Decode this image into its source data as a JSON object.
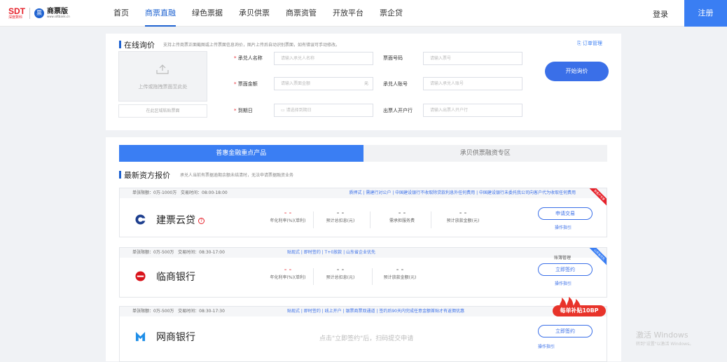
{
  "header": {
    "logo_sdt": "SDT",
    "logo_sdt_sub": "深度数科",
    "logo_name": "商票版",
    "logo_sub": "www.sdtbank.cn",
    "menu": [
      "首页",
      "商票直融",
      "绿色票据",
      "承贝供票",
      "商票资管",
      "开放平台",
      "票企贷"
    ],
    "active_menu": "商票直融",
    "login": "登录",
    "register": "注册"
  },
  "inquiry": {
    "title": "在线询价",
    "note": "支持上传商票正面截图或上传票面信息询价，图片上传后自动识别票面，如有错误可手动修改。",
    "order_mgmt": "订单管理",
    "upload_text": "上传或拖拽票面至此处",
    "paste_text": "在此区域粘贴票面",
    "fields": {
      "acceptor_label": "承兑人名称",
      "acceptor_ph": "请输入承兑人名称",
      "amount_label": "票面金额",
      "amount_ph": "请输入票面金额",
      "amount_unit": "元",
      "due_label": "到期日",
      "due_ph": "请选择到期日",
      "billno_label": "票面号码",
      "billno_ph": "请输入票号",
      "account_label": "承兑人账号",
      "account_ph": "请输入承兑人账号",
      "bank_label": "出票人开户行",
      "bank_ph": "请输入出票人开户行"
    },
    "start_button": "开始询价"
  },
  "tabs": [
    "普惠金融重点产品",
    "承贝供票融资专区"
  ],
  "assets": {
    "title": "最新资方报价",
    "note": "承兑人当前有票据逾期余额未结清时，无法申请票据融资业务"
  },
  "cards": [
    {
      "limit": "单张限额：0万-1000万",
      "hours": "交易时间：08:00-18:00",
      "tags": "质押式 | 需建行对公户 | 中国建设银行不收取除贷款利息外任何费用 | 中国建设银行未委托我公司向客户代为收取任何费用",
      "name": "建票云贷",
      "stats": [
        {
          "value": "- -",
          "label": "年化利率(%)(单利)",
          "red": true
        },
        {
          "value": "- -",
          "label": "预计总扣息(元)"
        },
        {
          "value": "- -",
          "label": "需承担服务费"
        },
        {
          "value": "- -",
          "label": "预计放款金额(元)"
        }
      ],
      "button": "申请交易",
      "guide": "操作指引",
      "ribbon": "新客户专享"
    },
    {
      "limit": "单张限额：0万-500万",
      "hours": "交易时间：08:30-17:00",
      "tags": "贴现式 | 即时签约 | T+0放款 | 山东省企业优先",
      "name": "临商银行",
      "stats": [
        {
          "value": "- -",
          "label": "年化利率(%)(单利)",
          "red": true
        },
        {
          "value": "- -",
          "label": "预计总扣息(元)"
        },
        {
          "value": "- -",
          "label": "预计放款金额(元)"
        }
      ],
      "extra_link": "账簿管理",
      "button": "立即签约",
      "guide": "操作指引",
      "ribbon": "山东省优先"
    },
    {
      "limit": "单张限额：0万-500万",
      "hours": "交易时间：08:30-17:30",
      "tags": "贴现式 | 即时签约 | 线上开户 | 银票商票双通道 | 签约后90天内完成任意金额首贴才有返佣优惠",
      "name": "网商银行",
      "hint": "点击\"立即签约\"后，扫码提交申请",
      "button": "立即签约",
      "guide": "操作指引",
      "subsidy": "每单补贴10BP"
    }
  ],
  "watermark": {
    "line1": "激活 Windows",
    "line2": "转到\"设置\"以激活 Windows。"
  },
  "colors": {
    "accent": "#3a7ef3",
    "primary_blue": "#1e62d0",
    "red": "#e6212a"
  }
}
